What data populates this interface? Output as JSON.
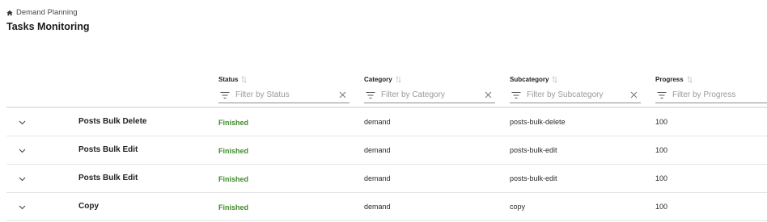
{
  "breadcrumb": {
    "icon": "home-icon",
    "label": "Demand Planning"
  },
  "page": {
    "title": "Tasks Monitoring"
  },
  "colors": {
    "status_finished": "#3f8a2a",
    "divider": "#e6e6e6"
  },
  "columns": [
    {
      "key": "status",
      "label": "Status",
      "filter_placeholder": "Filter by Status"
    },
    {
      "key": "category",
      "label": "Category",
      "filter_placeholder": "Filter by Category"
    },
    {
      "key": "subcategory",
      "label": "Subcategory",
      "filter_placeholder": "Filter by Subcategory"
    },
    {
      "key": "progress",
      "label": "Progress",
      "filter_placeholder": "Filter by Progress"
    }
  ],
  "rows": [
    {
      "name": "Posts Bulk Delete",
      "status": "Finished",
      "category": "demand",
      "subcategory": "posts-bulk-delete",
      "progress": "100"
    },
    {
      "name": "Posts Bulk Edit",
      "status": "Finished",
      "category": "demand",
      "subcategory": "posts-bulk-edit",
      "progress": "100"
    },
    {
      "name": "Posts Bulk Edit",
      "status": "Finished",
      "category": "demand",
      "subcategory": "posts-bulk-edit",
      "progress": "100"
    },
    {
      "name": "Copy",
      "status": "Finished",
      "category": "demand",
      "subcategory": "copy",
      "progress": "100"
    }
  ]
}
